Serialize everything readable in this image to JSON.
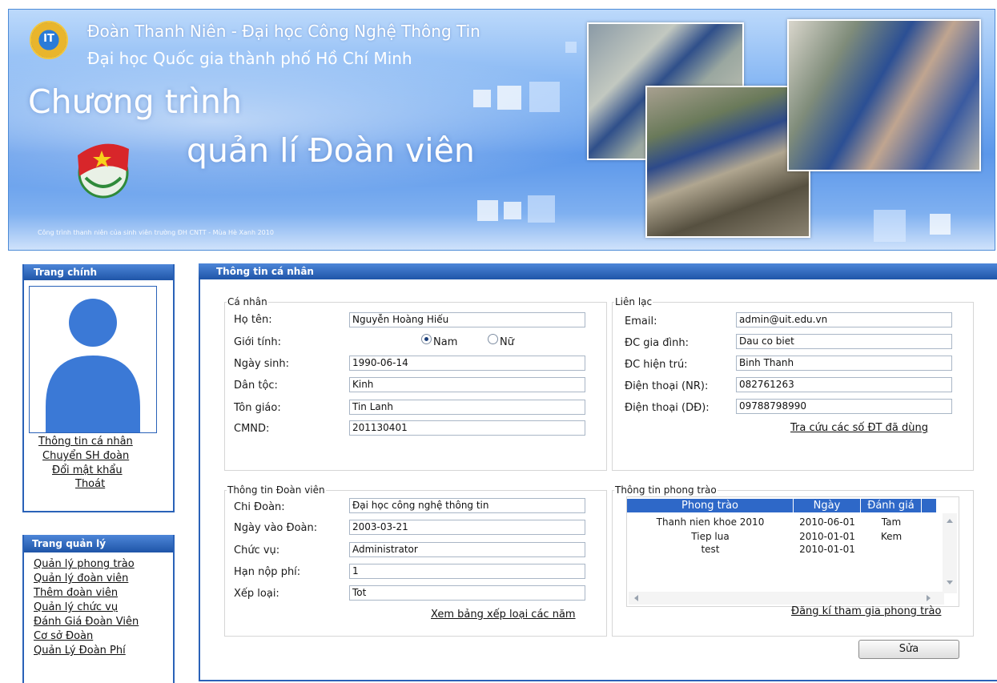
{
  "banner": {
    "line1": "Đoàn Thanh Niên - Đại học Công Nghệ Thông Tin",
    "line2": "Đại học Quốc gia thành phố Hồ Chí Minh",
    "title1": "Chương trình",
    "title2": "quản lí Đoàn viên",
    "footnote": "Công trình thanh niên của sinh viên trường ĐH CNTT - Mùa Hè Xanh 2010"
  },
  "sidebar_main": {
    "title": "Trang chính",
    "links": [
      "Thông tin cá nhân",
      "Chuyển SH đoàn",
      "Đổi mật khẩu",
      "Thoát"
    ]
  },
  "sidebar_admin": {
    "title": "Trang quản lý",
    "links": [
      "Quản lý phong trào",
      "Quản lý đoàn viên",
      "Thêm đoàn viên",
      "Quản lý chức vụ",
      "Đánh Giá Đoàn Viên",
      "Cơ sở Đoàn",
      "Quản Lý Đoàn Phí"
    ]
  },
  "main": {
    "title": "Thông tin cá nhân"
  },
  "personal": {
    "legend": "Cá nhân",
    "name_label": "Họ tên:",
    "name": "Nguyễn Hoàng Hiếu",
    "gender_label": "Giới tính:",
    "male": "Nam",
    "female": "Nữ",
    "dob_label": "Ngày sinh:",
    "dob": "1990-06-14",
    "ethnic_label": "Dân tộc:",
    "ethnic": "Kinh",
    "religion_label": "Tôn giáo:",
    "religion": "Tin Lanh",
    "id_label": "CMND:",
    "id": "201130401"
  },
  "contact": {
    "legend": "Liên lạc",
    "email_label": "Email:",
    "email": "admin@uit.edu.vn",
    "home_label": "ĐC gia đình:",
    "home": "Dau co biet",
    "current_label": "ĐC hiện trú:",
    "current": "Binh Thanh",
    "phone_home_label": "Điện thoại (NR):",
    "phone_home": "082761263",
    "phone_mobile_label": "Điện thoại (DĐ):",
    "phone_mobile": "09788798990",
    "lookup_link": "Tra cứu các số ĐT đã dùng"
  },
  "union": {
    "legend": "Thông tin Đoàn viên",
    "branch_label": "Chi Đoàn:",
    "branch": "Đại học công nghệ thông tin",
    "join_label": "Ngày vào Đoàn:",
    "join": "2003-03-21",
    "position_label": "Chức vụ:",
    "position": "Administrator",
    "fee_label": "Hạn nộp phí:",
    "fee": "1",
    "rank_label": "Xếp loại:",
    "rank": "Tot",
    "ranking_link": "Xem bảng xếp loại các năm"
  },
  "movement": {
    "legend": "Thông tin phong trào",
    "headers": [
      "Phong trào",
      "Ngày",
      "Đánh giá"
    ],
    "rows": [
      [
        "Thanh nien khoe 2010",
        "2010-06-01",
        "Tam"
      ],
      [
        "Tiep lua",
        "2010-01-01",
        "Kem"
      ],
      [
        "test",
        "2010-01-01",
        ""
      ]
    ],
    "register_link": "Đăng kí tham gia phong trào"
  },
  "edit_button": "Sửa",
  "colors": {
    "header_blue": "#1f55a8",
    "banner_blue": "#5b97ea",
    "grid_header": "#2e68c8"
  }
}
